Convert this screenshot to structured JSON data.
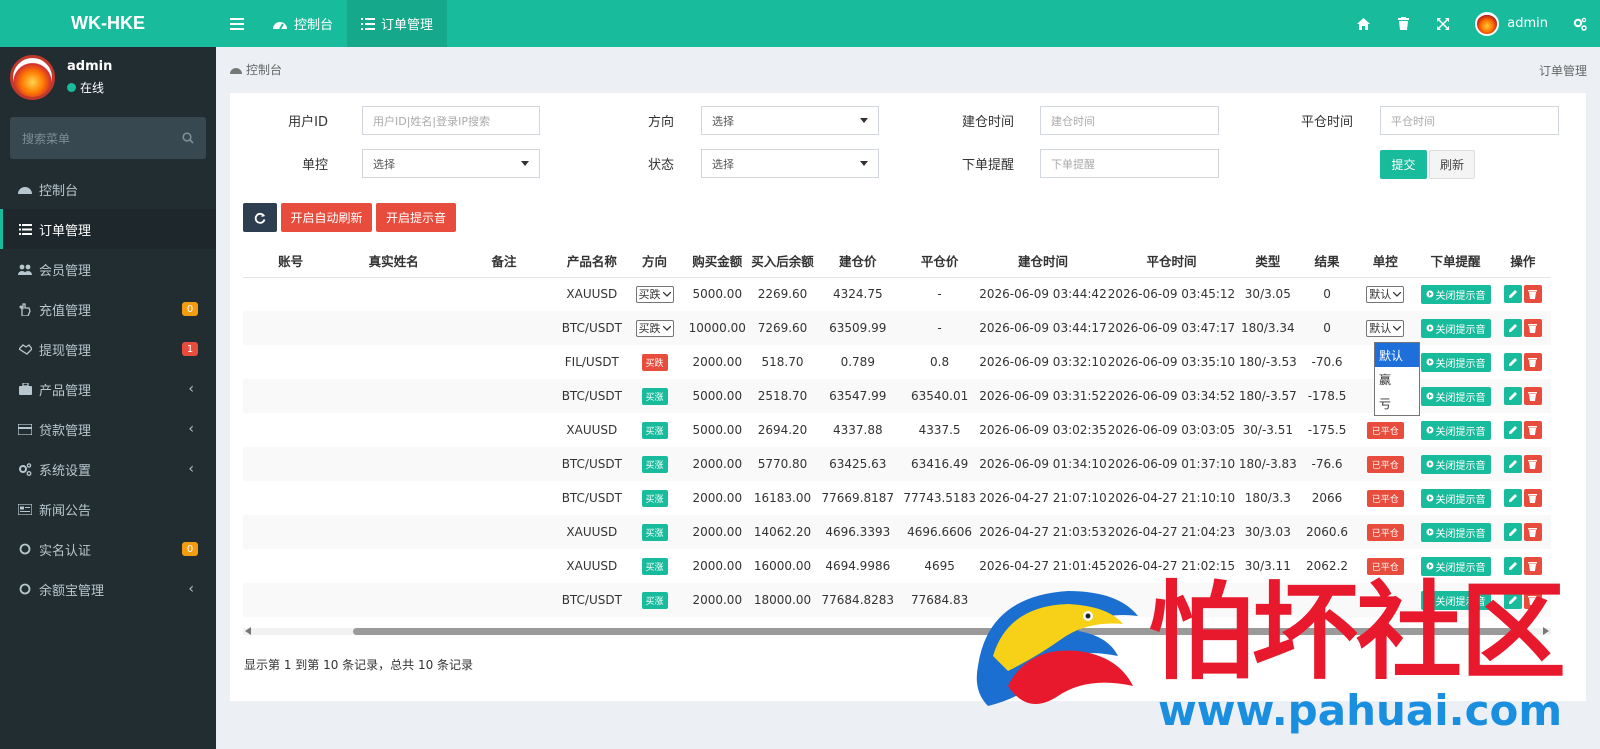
{
  "app": {
    "logo": "WK-HKE"
  },
  "topbar": {
    "tabs": [
      {
        "label": "控制台"
      },
      {
        "label": "订单管理"
      }
    ],
    "user": "admin"
  },
  "sidebar": {
    "user_name": "admin",
    "status": "在线",
    "search_placeholder": "搜索菜单",
    "items": [
      {
        "label": "控制台"
      },
      {
        "label": "订单管理"
      },
      {
        "label": "会员管理"
      },
      {
        "label": "充值管理",
        "badge": "0"
      },
      {
        "label": "提现管理",
        "badge": "1"
      },
      {
        "label": "产品管理"
      },
      {
        "label": "贷款管理"
      },
      {
        "label": "系统设置"
      },
      {
        "label": "新闻公告"
      },
      {
        "label": "实名认证",
        "badge": "0"
      },
      {
        "label": "余额宝管理"
      }
    ]
  },
  "breadcrumb": {
    "left": "控制台",
    "right": "订单管理"
  },
  "filters": {
    "user_id": {
      "label": "用户ID",
      "placeholder": "用户ID|姓名|登录IP搜索"
    },
    "direction": {
      "label": "方向",
      "value": "选择"
    },
    "open_time": {
      "label": "建仓时间",
      "placeholder": "建仓时间"
    },
    "close_time": {
      "label": "平仓时间",
      "placeholder": "平仓时间"
    },
    "control": {
      "label": "单控",
      "value": "选择"
    },
    "status": {
      "label": "状态",
      "value": "选择"
    },
    "order_alert": {
      "label": "下单提醒",
      "placeholder": "下单提醒"
    },
    "submit": "提交",
    "reset": "刷新"
  },
  "toolbar": {
    "auto_refresh": "开启自动刷新",
    "sound": "开启提示音"
  },
  "table": {
    "headers": [
      "账号",
      "真实姓名",
      "备注",
      "产品名称",
      "方向",
      "购买金额",
      "买入后余额",
      "建仓价",
      "平仓价",
      "建仓时间",
      "平仓时间",
      "类型",
      "结果",
      "单控",
      "下单提醒",
      "操作"
    ],
    "alert_label": "关闭提示音",
    "rows": [
      {
        "product": "XAUUSD",
        "direction": "买跌",
        "dir_kind": "select",
        "amount": "5000.00",
        "balance": "2269.60",
        "open_price": "4324.75",
        "close_price": "-",
        "open_time": "2026-06-09 03:44:42",
        "close_time": "2026-06-09 03:45:12",
        "type": "30/3.05",
        "result": "0",
        "control": "默认",
        "control_kind": "select"
      },
      {
        "product": "BTC/USDT",
        "direction": "买跌",
        "dir_kind": "select",
        "amount": "10000.00",
        "balance": "7269.60",
        "open_price": "63509.99",
        "close_price": "-",
        "open_time": "2026-06-09 03:44:17",
        "close_time": "2026-06-09 03:47:17",
        "type": "180/3.34",
        "result": "0",
        "control": "默认",
        "control_kind": "select"
      },
      {
        "product": "FIL/USDT",
        "direction": "买跌",
        "dir_kind": "down",
        "amount": "2000.00",
        "balance": "518.70",
        "open_price": "0.789",
        "close_price": "0.8",
        "open_time": "2026-06-09 03:32:10",
        "close_time": "2026-06-09 03:35:10",
        "type": "180/-3.53",
        "result": "-70.6",
        "control": "",
        "control_kind": "hidden"
      },
      {
        "product": "BTC/USDT",
        "direction": "买涨",
        "dir_kind": "up",
        "amount": "5000.00",
        "balance": "2518.70",
        "open_price": "63547.99",
        "close_price": "63540.01",
        "open_time": "2026-06-09 03:31:52",
        "close_time": "2026-06-09 03:34:52",
        "type": "180/-3.57",
        "result": "-178.5",
        "control": "",
        "control_kind": "hidden"
      },
      {
        "product": "XAUUSD",
        "direction": "买涨",
        "dir_kind": "up",
        "amount": "5000.00",
        "balance": "2694.20",
        "open_price": "4337.88",
        "close_price": "4337.5",
        "open_time": "2026-06-09 03:02:35",
        "close_time": "2026-06-09 03:03:05",
        "type": "30/-3.51",
        "result": "-175.5",
        "control": "已平仓",
        "control_kind": "closed"
      },
      {
        "product": "BTC/USDT",
        "direction": "买涨",
        "dir_kind": "up",
        "amount": "2000.00",
        "balance": "5770.80",
        "open_price": "63425.63",
        "close_price": "63416.49",
        "open_time": "2026-06-09 01:34:10",
        "close_time": "2026-06-09 01:37:10",
        "type": "180/-3.83",
        "result": "-76.6",
        "control": "已平仓",
        "control_kind": "closed"
      },
      {
        "product": "BTC/USDT",
        "direction": "买涨",
        "dir_kind": "up",
        "amount": "2000.00",
        "balance": "16183.00",
        "open_price": "77669.8187",
        "close_price": "77743.5183",
        "open_time": "2026-04-27 21:07:10",
        "close_time": "2026-04-27 21:10:10",
        "type": "180/3.3",
        "result": "2066",
        "control": "已平仓",
        "control_kind": "closed"
      },
      {
        "product": "XAUUSD",
        "direction": "买涨",
        "dir_kind": "up",
        "amount": "2000.00",
        "balance": "14062.20",
        "open_price": "4696.3393",
        "close_price": "4696.6606",
        "open_time": "2026-04-27 21:03:53",
        "close_time": "2026-04-27 21:04:23",
        "type": "30/3.03",
        "result": "2060.6",
        "control": "已平仓",
        "control_kind": "closed"
      },
      {
        "product": "XAUUSD",
        "direction": "买涨",
        "dir_kind": "up",
        "amount": "2000.00",
        "balance": "16000.00",
        "open_price": "4694.9986",
        "close_price": "4695",
        "open_time": "2026-04-27 21:01:45",
        "close_time": "2026-04-27 21:02:15",
        "type": "30/3.11",
        "result": "2062.2",
        "control": "已平仓",
        "control_kind": "closed"
      },
      {
        "product": "BTC/USDT",
        "direction": "买涨",
        "dir_kind": "up",
        "amount": "2000.00",
        "balance": "18000.00",
        "open_price": "77684.8283",
        "close_price": "77684.83",
        "open_time": "",
        "close_time": "",
        "type": "",
        "result": "",
        "control": "",
        "control_kind": "hidden"
      }
    ]
  },
  "dropdown_options": [
    "默认",
    "赢",
    "亏"
  ],
  "pagination": {
    "summary": "显示第 1 到第 10 条记录，总共 10 条记录"
  },
  "watermark": {
    "title": "怕坏社区",
    "url": "www.pahuai.com"
  },
  "colors": {
    "primary": "#18bc9c",
    "sidebar": "#222d32",
    "danger": "#e74c3c",
    "warning": "#f39c12"
  }
}
